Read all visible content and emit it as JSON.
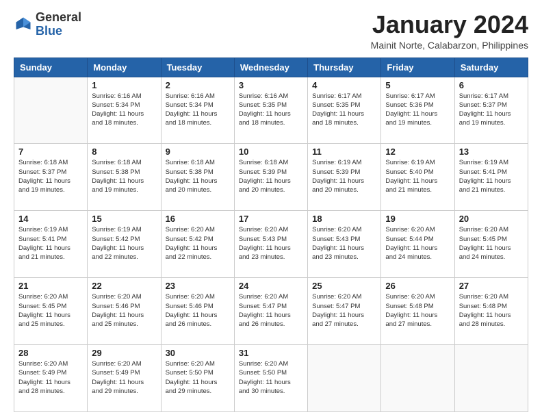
{
  "header": {
    "logo": {
      "general": "General",
      "blue": "Blue"
    },
    "title": "January 2024",
    "subtitle": "Mainit Norte, Calabarzon, Philippines"
  },
  "days_of_week": [
    "Sunday",
    "Monday",
    "Tuesday",
    "Wednesday",
    "Thursday",
    "Friday",
    "Saturday"
  ],
  "weeks": [
    [
      {
        "day": "",
        "info": ""
      },
      {
        "day": "1",
        "info": "Sunrise: 6:16 AM\nSunset: 5:34 PM\nDaylight: 11 hours and 18 minutes."
      },
      {
        "day": "2",
        "info": "Sunrise: 6:16 AM\nSunset: 5:34 PM\nDaylight: 11 hours and 18 minutes."
      },
      {
        "day": "3",
        "info": "Sunrise: 6:16 AM\nSunset: 5:35 PM\nDaylight: 11 hours and 18 minutes."
      },
      {
        "day": "4",
        "info": "Sunrise: 6:17 AM\nSunset: 5:35 PM\nDaylight: 11 hours and 18 minutes."
      },
      {
        "day": "5",
        "info": "Sunrise: 6:17 AM\nSunset: 5:36 PM\nDaylight: 11 hours and 19 minutes."
      },
      {
        "day": "6",
        "info": "Sunrise: 6:17 AM\nSunset: 5:37 PM\nDaylight: 11 hours and 19 minutes."
      }
    ],
    [
      {
        "day": "7",
        "info": "Sunrise: 6:18 AM\nSunset: 5:37 PM\nDaylight: 11 hours and 19 minutes."
      },
      {
        "day": "8",
        "info": "Sunrise: 6:18 AM\nSunset: 5:38 PM\nDaylight: 11 hours and 19 minutes."
      },
      {
        "day": "9",
        "info": "Sunrise: 6:18 AM\nSunset: 5:38 PM\nDaylight: 11 hours and 20 minutes."
      },
      {
        "day": "10",
        "info": "Sunrise: 6:18 AM\nSunset: 5:39 PM\nDaylight: 11 hours and 20 minutes."
      },
      {
        "day": "11",
        "info": "Sunrise: 6:19 AM\nSunset: 5:39 PM\nDaylight: 11 hours and 20 minutes."
      },
      {
        "day": "12",
        "info": "Sunrise: 6:19 AM\nSunset: 5:40 PM\nDaylight: 11 hours and 21 minutes."
      },
      {
        "day": "13",
        "info": "Sunrise: 6:19 AM\nSunset: 5:41 PM\nDaylight: 11 hours and 21 minutes."
      }
    ],
    [
      {
        "day": "14",
        "info": "Sunrise: 6:19 AM\nSunset: 5:41 PM\nDaylight: 11 hours and 21 minutes."
      },
      {
        "day": "15",
        "info": "Sunrise: 6:19 AM\nSunset: 5:42 PM\nDaylight: 11 hours and 22 minutes."
      },
      {
        "day": "16",
        "info": "Sunrise: 6:20 AM\nSunset: 5:42 PM\nDaylight: 11 hours and 22 minutes."
      },
      {
        "day": "17",
        "info": "Sunrise: 6:20 AM\nSunset: 5:43 PM\nDaylight: 11 hours and 23 minutes."
      },
      {
        "day": "18",
        "info": "Sunrise: 6:20 AM\nSunset: 5:43 PM\nDaylight: 11 hours and 23 minutes."
      },
      {
        "day": "19",
        "info": "Sunrise: 6:20 AM\nSunset: 5:44 PM\nDaylight: 11 hours and 24 minutes."
      },
      {
        "day": "20",
        "info": "Sunrise: 6:20 AM\nSunset: 5:45 PM\nDaylight: 11 hours and 24 minutes."
      }
    ],
    [
      {
        "day": "21",
        "info": "Sunrise: 6:20 AM\nSunset: 5:45 PM\nDaylight: 11 hours and 25 minutes."
      },
      {
        "day": "22",
        "info": "Sunrise: 6:20 AM\nSunset: 5:46 PM\nDaylight: 11 hours and 25 minutes."
      },
      {
        "day": "23",
        "info": "Sunrise: 6:20 AM\nSunset: 5:46 PM\nDaylight: 11 hours and 26 minutes."
      },
      {
        "day": "24",
        "info": "Sunrise: 6:20 AM\nSunset: 5:47 PM\nDaylight: 11 hours and 26 minutes."
      },
      {
        "day": "25",
        "info": "Sunrise: 6:20 AM\nSunset: 5:47 PM\nDaylight: 11 hours and 27 minutes."
      },
      {
        "day": "26",
        "info": "Sunrise: 6:20 AM\nSunset: 5:48 PM\nDaylight: 11 hours and 27 minutes."
      },
      {
        "day": "27",
        "info": "Sunrise: 6:20 AM\nSunset: 5:48 PM\nDaylight: 11 hours and 28 minutes."
      }
    ],
    [
      {
        "day": "28",
        "info": "Sunrise: 6:20 AM\nSunset: 5:49 PM\nDaylight: 11 hours and 28 minutes."
      },
      {
        "day": "29",
        "info": "Sunrise: 6:20 AM\nSunset: 5:49 PM\nDaylight: 11 hours and 29 minutes."
      },
      {
        "day": "30",
        "info": "Sunrise: 6:20 AM\nSunset: 5:50 PM\nDaylight: 11 hours and 29 minutes."
      },
      {
        "day": "31",
        "info": "Sunrise: 6:20 AM\nSunset: 5:50 PM\nDaylight: 11 hours and 30 minutes."
      },
      {
        "day": "",
        "info": ""
      },
      {
        "day": "",
        "info": ""
      },
      {
        "day": "",
        "info": ""
      }
    ]
  ]
}
